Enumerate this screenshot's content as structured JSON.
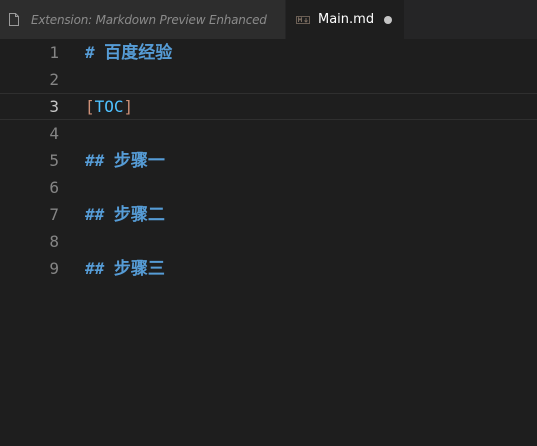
{
  "tabs": [
    {
      "label": "Extension: Markdown Preview Enhanced",
      "icon": "file-icon",
      "active": false
    },
    {
      "label": "Main.md",
      "icon": "markdown-file-icon",
      "active": true,
      "dirty": true
    }
  ],
  "editor": {
    "current_line": 3,
    "lines": [
      {
        "number": "1",
        "marker": "#",
        "text": "百度经验"
      },
      {
        "number": "2"
      },
      {
        "number": "3",
        "open": "[",
        "word": "TOC",
        "close": "]"
      },
      {
        "number": "4"
      },
      {
        "number": "5",
        "marker": "##",
        "text": "步骤一"
      },
      {
        "number": "6"
      },
      {
        "number": "7",
        "marker": "##",
        "text": "步骤二"
      },
      {
        "number": "8"
      },
      {
        "number": "9",
        "marker": "##",
        "text": "步骤三"
      }
    ]
  },
  "colors": {
    "background": "#1e1e1e",
    "heading": "#569cd6",
    "bracket": "#ce9178",
    "toc": "#4fc1ff",
    "line_number": "#858585"
  }
}
